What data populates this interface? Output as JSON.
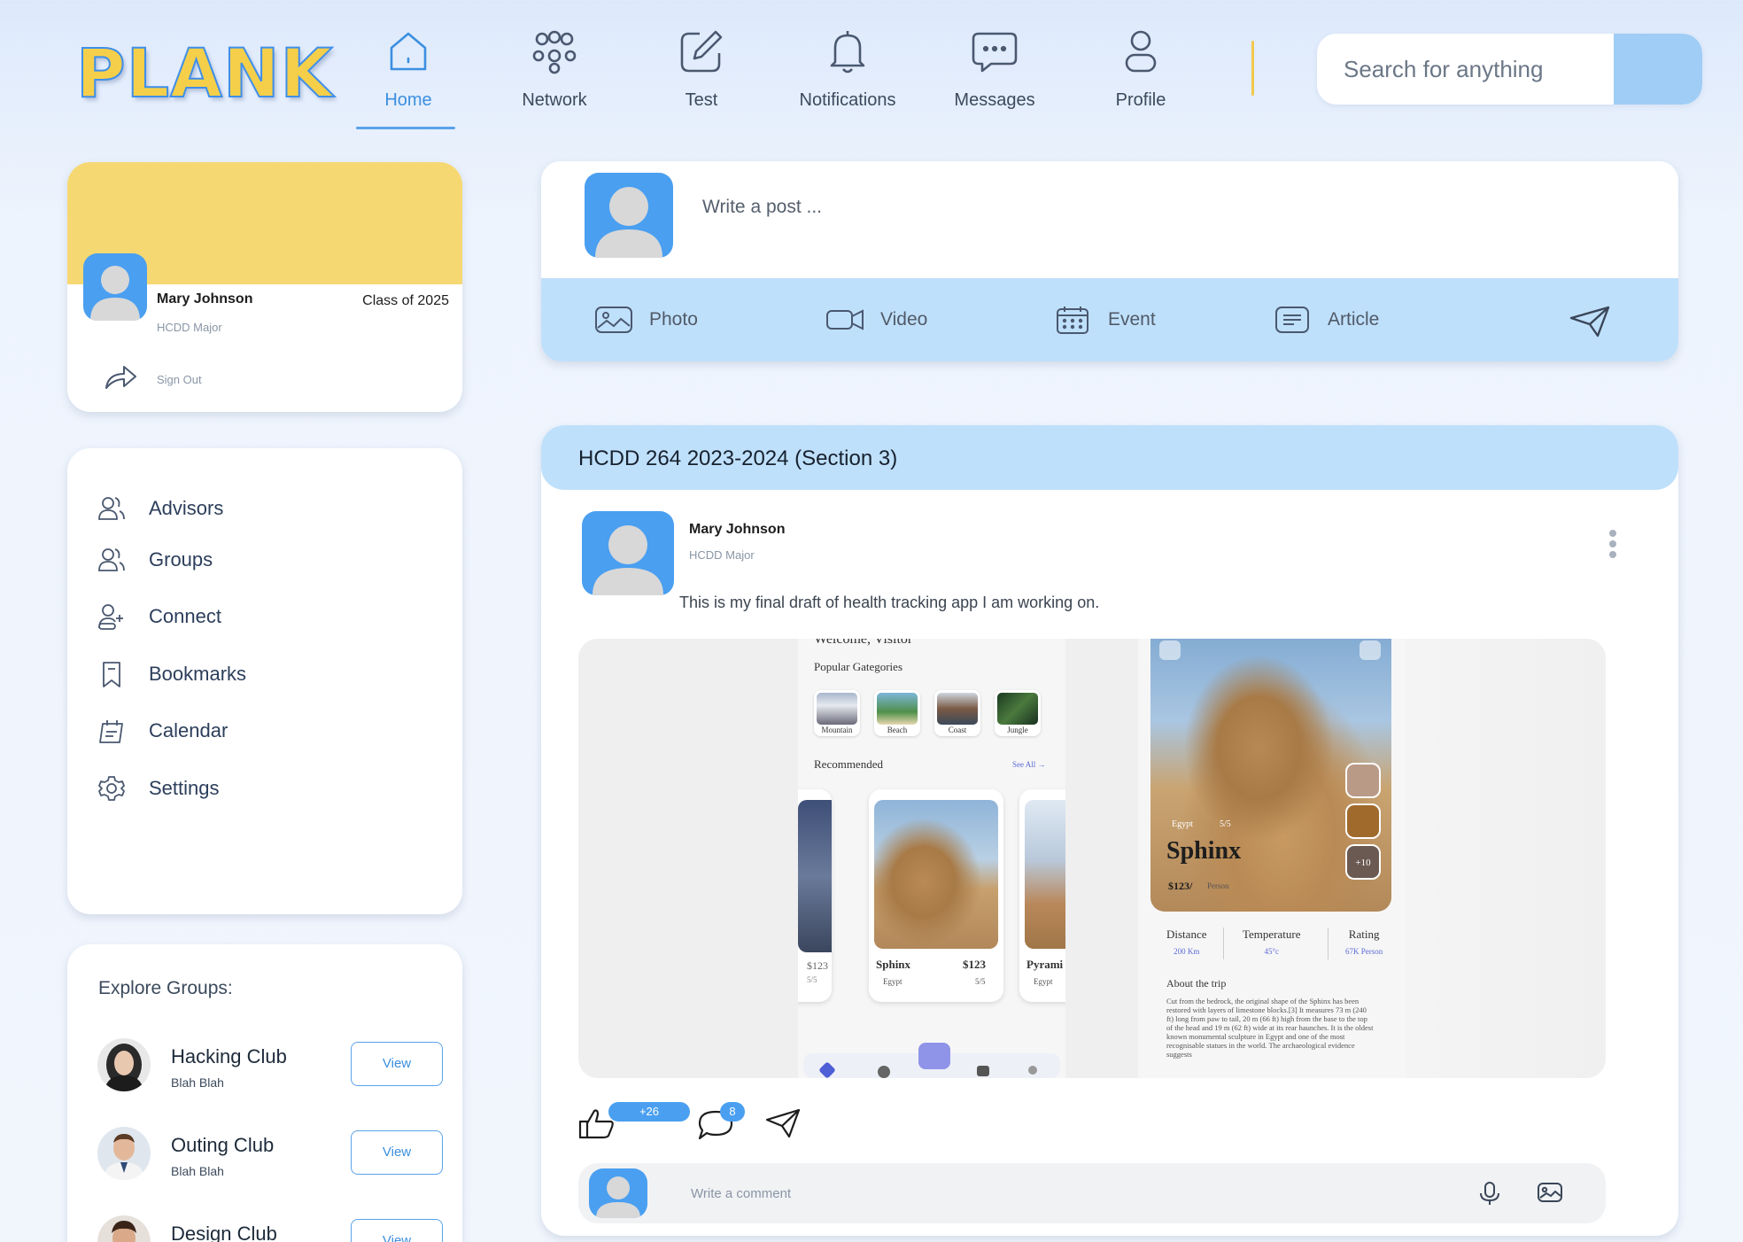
{
  "app": {
    "logo": "PLANK"
  },
  "nav": {
    "items": [
      {
        "label": "Home",
        "icon": "home-icon"
      },
      {
        "label": "Network",
        "icon": "network-icon"
      },
      {
        "label": "Test",
        "icon": "edit-icon"
      },
      {
        "label": "Notifications",
        "icon": "bell-icon"
      },
      {
        "label": "Messages",
        "icon": "chat-icon"
      },
      {
        "label": "Profile",
        "icon": "user-icon"
      }
    ],
    "active": "Home"
  },
  "search": {
    "placeholder": "Search for anything"
  },
  "profile": {
    "name": "Mary Johnson",
    "class": "Class of 2025",
    "major": "HCDD Major",
    "sign_out": "Sign Out"
  },
  "menu": {
    "items": [
      {
        "label": "Advisors",
        "icon": "users-icon"
      },
      {
        "label": "Groups",
        "icon": "users-icon"
      },
      {
        "label": "Connect",
        "icon": "user-plus-icon"
      },
      {
        "label": "Bookmarks",
        "icon": "bookmark-icon"
      },
      {
        "label": "Calendar",
        "icon": "calendar-icon"
      },
      {
        "label": "Settings",
        "icon": "gear-icon"
      }
    ]
  },
  "groups": {
    "title": "Explore Groups:",
    "items": [
      {
        "name": "Hacking Club",
        "subtitle": "Blah Blah",
        "button": "View"
      },
      {
        "name": "Outing Club",
        "subtitle": "Blah Blah",
        "button": "View"
      },
      {
        "name": "Design Club",
        "subtitle": "",
        "button": "View"
      }
    ]
  },
  "composer": {
    "placeholder": "Write a post ...",
    "actions": [
      {
        "label": "Photo",
        "icon": "photo-icon"
      },
      {
        "label": "Video",
        "icon": "video-icon"
      },
      {
        "label": "Event",
        "icon": "calendar-icon"
      },
      {
        "label": "Article",
        "icon": "article-icon"
      }
    ]
  },
  "post": {
    "group_title": "HCDD 264 2023-2024 (Section 3)",
    "author": "Mary Johnson",
    "author_major": "HCDD Major",
    "text": "This is my final draft of health tracking app I am working on.",
    "reactions_count": "+26",
    "comments_count": "8",
    "comment_placeholder": "Write a comment"
  },
  "mock_app": {
    "greeting": "Welcome, Visitor",
    "popular_title": "Popular Gategories",
    "categories": [
      "Mountain",
      "Beach",
      "Coast",
      "Jungle"
    ],
    "recommended_title": "Recommended",
    "see_all": "See All →",
    "cards": [
      {
        "price": "$123",
        "rating": "5/5"
      },
      {
        "name": "Sphinx",
        "price": "$123",
        "location": "Egypt",
        "rating": "5/5"
      },
      {
        "name": "Pyrami",
        "location": "Egypt"
      }
    ],
    "detail": {
      "location": "Egypt",
      "rating": "5/5",
      "name": "Sphinx",
      "price": "$123/",
      "per": "Person",
      "more": "+10",
      "stats": [
        {
          "label": "Distance",
          "value": "200 Km"
        },
        {
          "label": "Temperature",
          "value": "45°c"
        },
        {
          "label": "Rating",
          "value": "67K Person"
        }
      ],
      "about_title": "About the trip",
      "about_text": "Cut from the bedrock, the original shape of the Sphinx has been restored with layers of limestone blocks.[3] It measures 73 m (240 ft) long from paw to tail, 20 m (66 ft) high from the base to the top of the head and 19 m (62 ft) wide at its rear haunches. It is the oldest known monumental sculpture in Egypt and one of the most recognisable statues in the world. The archaeological evidence suggests"
    }
  },
  "colors": {
    "accent": "#3b8fe0",
    "banner": "#f6d873",
    "avatar": "#4a9ff0",
    "bar": "#bfe0fb"
  }
}
